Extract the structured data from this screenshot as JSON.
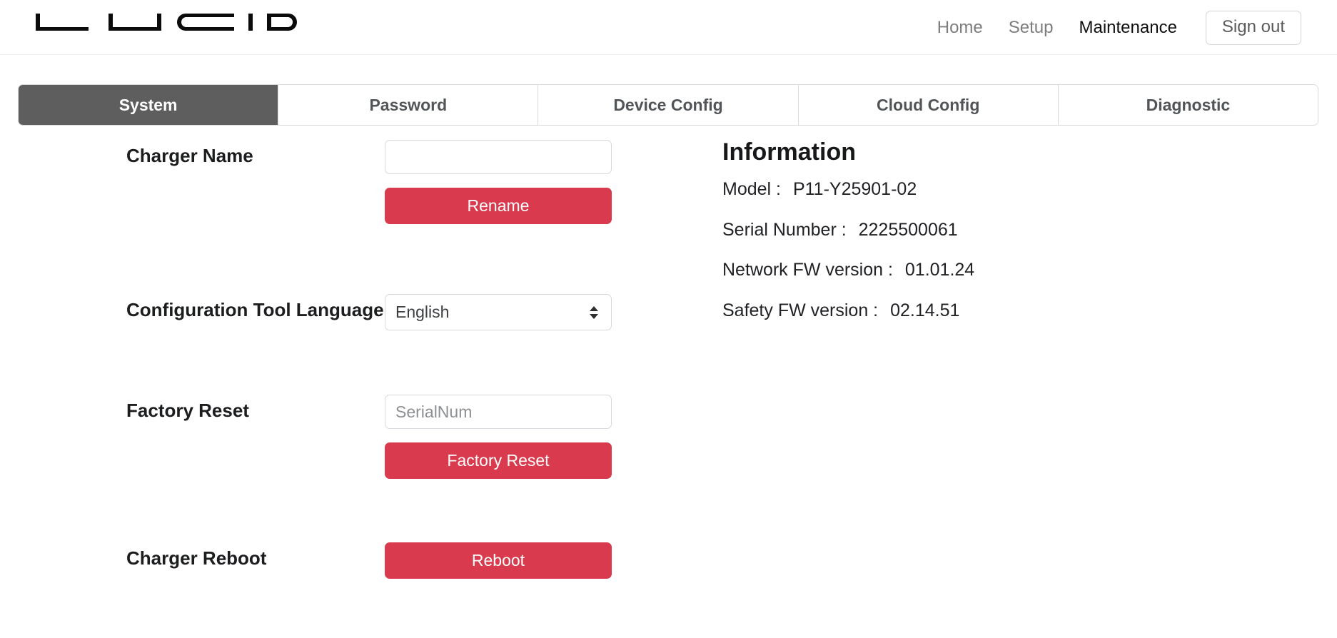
{
  "header": {
    "logo_text": "LUCID",
    "nav": [
      {
        "label": "Home",
        "active": false
      },
      {
        "label": "Setup",
        "active": false
      },
      {
        "label": "Maintenance",
        "active": true
      }
    ],
    "signout_label": "Sign out"
  },
  "tabs": [
    {
      "label": "System",
      "active": true
    },
    {
      "label": "Password",
      "active": false
    },
    {
      "label": "Device Config",
      "active": false
    },
    {
      "label": "Cloud Config",
      "active": false
    },
    {
      "label": "Diagnostic",
      "active": false
    }
  ],
  "form": {
    "charger_name": {
      "label": "Charger Name",
      "input_value": "",
      "input_placeholder": "",
      "button_label": "Rename"
    },
    "language": {
      "label": "Configuration Tool Language",
      "selected": "English"
    },
    "factory_reset": {
      "label": "Factory Reset",
      "input_value": "",
      "input_placeholder": "SerialNum",
      "button_label": "Factory Reset"
    },
    "reboot": {
      "label": "Charger Reboot",
      "button_label": "Reboot"
    }
  },
  "information": {
    "title": "Information",
    "rows": [
      {
        "label": "Model :",
        "value": "P11-Y25901-02"
      },
      {
        "label": "Serial Number :",
        "value": "2225500061"
      },
      {
        "label": "Network FW version :",
        "value": "01.01.24"
      },
      {
        "label": "Safety FW version :",
        "value": "02.14.51"
      }
    ]
  },
  "colors": {
    "accent_red": "#d93a4d",
    "active_tab_gray": "#5e5e5e",
    "border_gray": "#d6d9dd"
  }
}
